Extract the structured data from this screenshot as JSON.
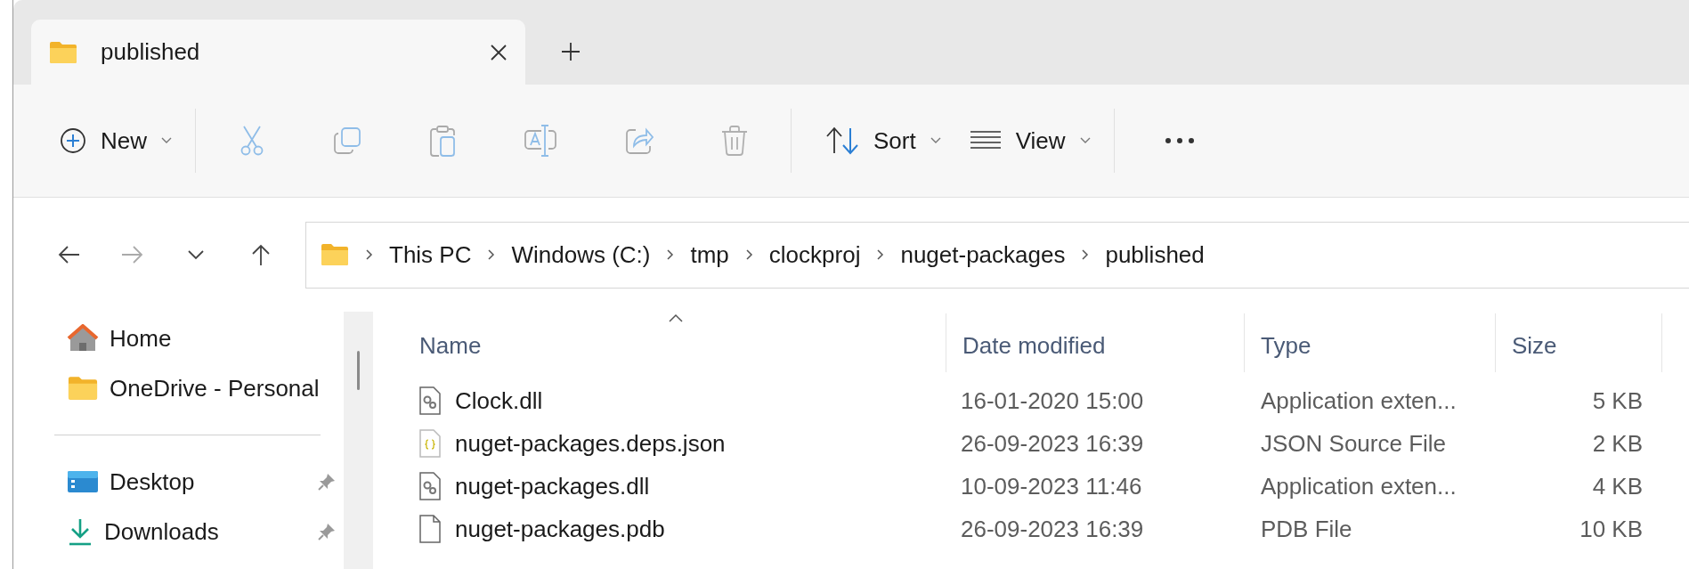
{
  "tabs": [
    {
      "label": "published",
      "selected": true
    }
  ],
  "toolbar": [
    {
      "kind": "new",
      "label": "New",
      "disabled": false
    },
    {
      "kind": "cut",
      "disabled": true
    },
    {
      "kind": "copy",
      "disabled": true
    },
    {
      "kind": "paste",
      "disabled": true
    },
    {
      "kind": "rename",
      "disabled": true
    },
    {
      "kind": "share",
      "disabled": true
    },
    {
      "kind": "delete",
      "disabled": true
    },
    {
      "kind": "sort",
      "label": "Sort",
      "disabled": false
    },
    {
      "kind": "view",
      "label": "View",
      "disabled": false
    },
    {
      "kind": "more",
      "disabled": false
    }
  ],
  "nav": [
    {
      "kind": "back",
      "disabled": false
    },
    {
      "kind": "forward",
      "disabled": true
    },
    {
      "kind": "recent",
      "disabled": false
    },
    {
      "kind": "up",
      "disabled": false
    }
  ],
  "address": {
    "crumbs": [
      "This PC",
      "Windows (C:)",
      "tmp",
      "clockproj",
      "nuget-packages",
      "published"
    ]
  },
  "sidebar": {
    "groups": [
      [
        {
          "kind": "home",
          "label": "Home",
          "pinned": false
        },
        {
          "kind": "folder",
          "label": "OneDrive - Personal",
          "pinned": false
        }
      ],
      [
        {
          "kind": "desktop",
          "label": "Desktop",
          "pinned": true
        },
        {
          "kind": "downloads",
          "label": "Downloads",
          "pinned": true
        }
      ]
    ]
  },
  "file_list": {
    "columns": [
      {
        "label": "Name",
        "sorted": true
      },
      {
        "label": "Date modified",
        "sorted": false
      },
      {
        "label": "Type",
        "sorted": false
      },
      {
        "label": "Size",
        "sorted": false
      }
    ],
    "rows": [
      {
        "kind": "dll",
        "name": "Clock.dll",
        "date": "16-01-2020 15:00",
        "type": "Application exten...",
        "size": "5 KB"
      },
      {
        "kind": "json",
        "name": "nuget-packages.deps.json",
        "date": "26-09-2023 16:39",
        "type": "JSON Source File",
        "size": "2 KB"
      },
      {
        "kind": "dll",
        "name": "nuget-packages.dll",
        "date": "10-09-2023 11:46",
        "type": "Application exten...",
        "size": "4 KB"
      },
      {
        "kind": "file",
        "name": "nuget-packages.pdb",
        "date": "26-09-2023 16:39",
        "type": "PDB File",
        "size": "10 KB"
      }
    ]
  }
}
